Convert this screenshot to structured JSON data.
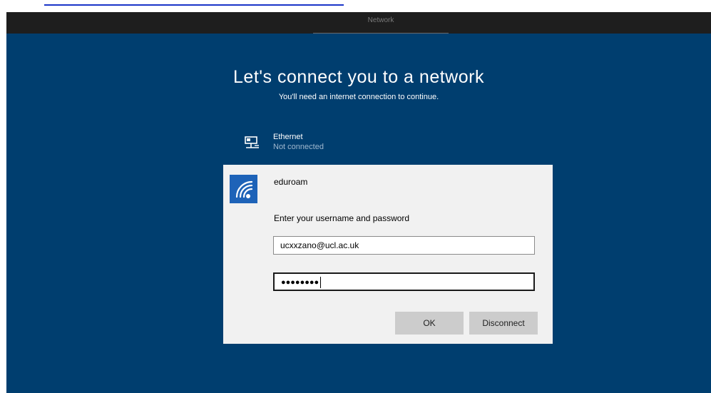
{
  "window": {
    "title": "Network"
  },
  "main": {
    "heading": "Let's connect you to a network",
    "subheading": "You'll need an internet connection to continue."
  },
  "ethernet": {
    "name": "Ethernet",
    "status": "Not connected",
    "icon": "ethernet-icon"
  },
  "wifi": {
    "network_name": "eduroam",
    "icon": "wifi-icon",
    "prompt": "Enter your username and password",
    "username_value": "ucxxzano@ucl.ac.uk",
    "password_mask": "●●●●●●●●",
    "ok_label": "OK",
    "disconnect_label": "Disconnect"
  },
  "colors": {
    "background": "#003e6f",
    "top_bar": "#1e1e1e",
    "wifi_tile": "#1e63b8",
    "panel": "#f1f1f1"
  }
}
